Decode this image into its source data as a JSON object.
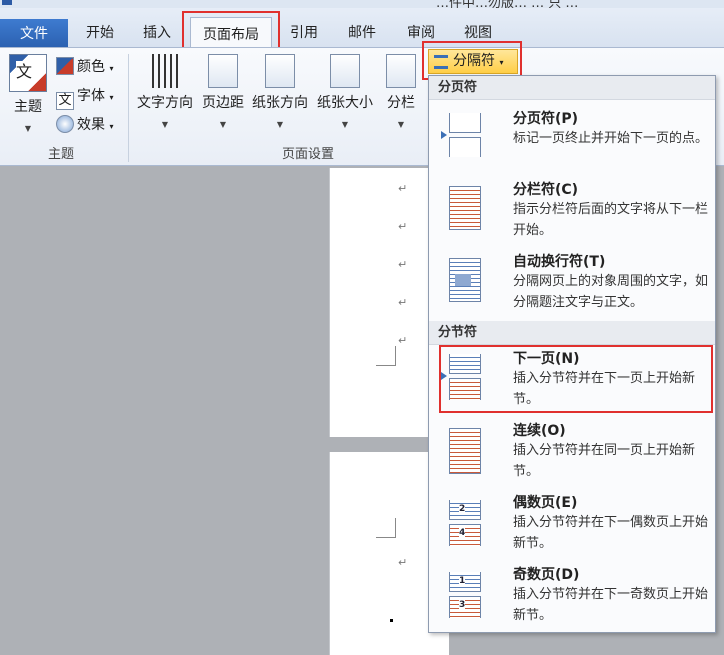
{
  "window": {
    "title_fragment": "…件中…勿版… … 只 …"
  },
  "tabs": {
    "file": "文件",
    "home": "开始",
    "insert": "插入",
    "page_layout": "页面布局",
    "references": "引用",
    "mailings": "邮件",
    "review": "审阅",
    "view": "视图"
  },
  "ribbon": {
    "themes": {
      "themes_btn": "主题",
      "colors": "颜色",
      "fonts": "字体",
      "effects": "效果",
      "group_label": "主题"
    },
    "page_setup": {
      "text_direction": "文字方向",
      "margins": "页边距",
      "orientation": "纸张方向",
      "size": "纸张大小",
      "columns": "分栏",
      "breaks": "分隔符",
      "group_label": "页面设置"
    }
  },
  "breaks_menu": {
    "page_breaks_header": "分页符",
    "section_breaks_header": "分节符",
    "items": [
      {
        "title": "分页符(P)",
        "desc": "标记一页终止并开始下一页的点。"
      },
      {
        "title": "分栏符(C)",
        "desc": "指示分栏符后面的文字将从下一栏开始。"
      },
      {
        "title": "自动换行符(T)",
        "desc": "分隔网页上的对象周围的文字，如分隔题注文字与正文。"
      },
      {
        "title": "下一页(N)",
        "desc": "插入分节符并在下一页上开始新节。"
      },
      {
        "title": "连续(O)",
        "desc": "插入分节符并在同一页上开始新节。"
      },
      {
        "title": "偶数页(E)",
        "desc": "插入分节符并在下一偶数页上开始新节。"
      },
      {
        "title": "奇数页(D)",
        "desc": "插入分节符并在下一奇数页上开始新节。"
      }
    ]
  },
  "document": {
    "paragraph_mark": "↵"
  },
  "icons": {
    "even_page_numbers": [
      "2",
      "4"
    ],
    "odd_page_numbers": [
      "1",
      "3"
    ]
  },
  "colors": {
    "highlight": "#e0302e",
    "breaks_button": "#ffce47",
    "file_tab": "#2a5fae"
  }
}
